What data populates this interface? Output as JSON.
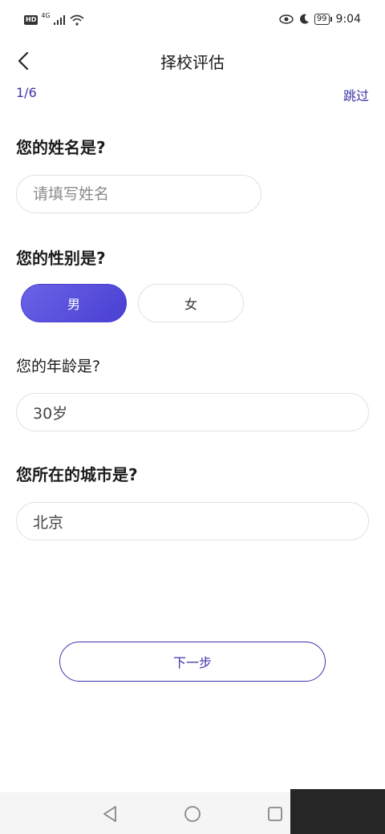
{
  "status_bar": {
    "hd": "HD",
    "network": "4G",
    "battery": "99",
    "time": "9:04"
  },
  "nav": {
    "title": "择校评估"
  },
  "progress": {
    "step": "1/6",
    "skip": "跳过"
  },
  "form": {
    "name_question": "您的姓名是?",
    "name_placeholder": "请填写姓名",
    "name_value": "",
    "gender_question": "您的性别是?",
    "gender_male": "男",
    "gender_female": "女",
    "age_question": "您的年龄是?",
    "age_value": "30岁",
    "city_question": "您所在的城市是?",
    "city_value": "北京"
  },
  "actions": {
    "next": "下一步"
  },
  "colors": {
    "accent": "#3b34a8",
    "selected_gradient_start": "#6a63e6",
    "selected_gradient_end": "#4a3fd2"
  }
}
